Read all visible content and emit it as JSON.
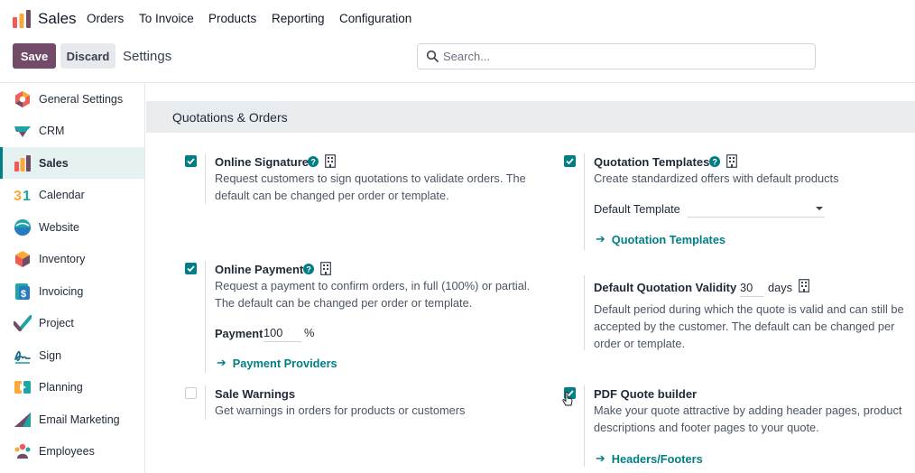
{
  "navbar": {
    "app_name": "Sales",
    "menus": [
      "Orders",
      "To Invoice",
      "Products",
      "Reporting",
      "Configuration"
    ]
  },
  "control_panel": {
    "save_label": "Save",
    "discard_label": "Discard",
    "breadcrumb": "Settings",
    "search_placeholder": "Search..."
  },
  "sidebar": {
    "items": [
      {
        "label": "General Settings",
        "icon": "general-settings-icon"
      },
      {
        "label": "CRM",
        "icon": "crm-icon"
      },
      {
        "label": "Sales",
        "icon": "sales-icon",
        "active": true
      },
      {
        "label": "Calendar",
        "icon": "calendar-icon"
      },
      {
        "label": "Website",
        "icon": "website-icon"
      },
      {
        "label": "Inventory",
        "icon": "inventory-icon"
      },
      {
        "label": "Invoicing",
        "icon": "invoicing-icon"
      },
      {
        "label": "Project",
        "icon": "project-icon"
      },
      {
        "label": "Sign",
        "icon": "sign-icon"
      },
      {
        "label": "Planning",
        "icon": "planning-icon"
      },
      {
        "label": "Email Marketing",
        "icon": "email-marketing-icon"
      },
      {
        "label": "Employees",
        "icon": "employees-icon"
      }
    ]
  },
  "section": {
    "title": "Quotations & Orders"
  },
  "settings": {
    "online_signature": {
      "title": "Online Signature",
      "checked": true,
      "desc1": "Request customers to sign quotations to validate orders. The",
      "desc2": "default can be changed per order or template."
    },
    "quotation_templates": {
      "title": "Quotation Templates",
      "checked": true,
      "desc": "Create standardized offers with default products",
      "default_template_label": "Default Template",
      "default_template_value": "",
      "link": "Quotation Templates"
    },
    "online_payment": {
      "title": "Online Payment",
      "checked": true,
      "desc1": "Request a payment to confirm orders, in full (100%) or partial.",
      "desc2": "The default can be changed per order or template.",
      "payment_label": "Payment",
      "payment_value": "100",
      "payment_unit": "%",
      "link": "Payment Providers"
    },
    "quotation_validity": {
      "title": "Default Quotation Validity",
      "value": "30",
      "unit": "days",
      "desc1": "Default period during which the quote is valid and can still be",
      "desc2": "accepted by the customer. The default can be changed per",
      "desc3": "order or template."
    },
    "sale_warnings": {
      "title": "Sale Warnings",
      "checked": false,
      "desc": "Get warnings in orders for products or customers"
    },
    "pdf_quote_builder": {
      "title": "PDF Quote builder",
      "checked": true,
      "desc1": "Make your quote attractive by adding header pages, product",
      "desc2": "descriptions and footer pages to your quote.",
      "link": "Headers/Footers"
    }
  },
  "colors": {
    "brand": "#714b67",
    "accent": "#017e84"
  }
}
